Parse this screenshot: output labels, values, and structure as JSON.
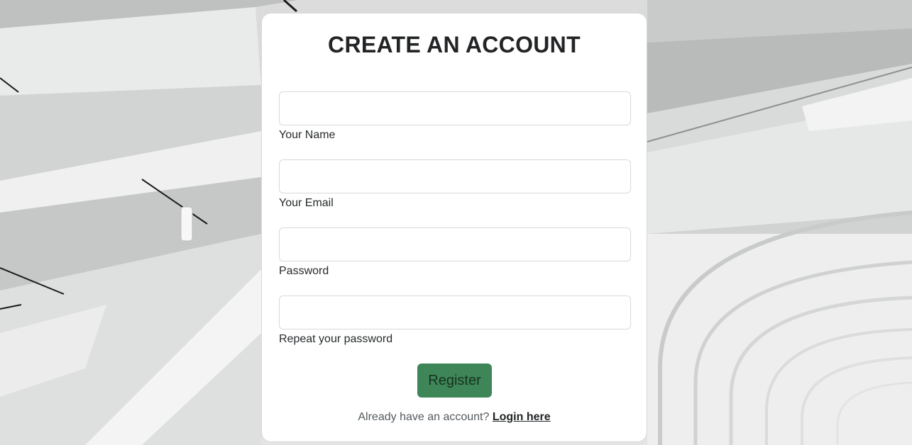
{
  "form": {
    "title": "CREATE AN ACCOUNT",
    "fields": [
      {
        "label": "Your Name",
        "value": "",
        "type": "text"
      },
      {
        "label": "Your Email",
        "value": "",
        "type": "email"
      },
      {
        "label": "Password",
        "value": "",
        "type": "password"
      },
      {
        "label": "Repeat your password",
        "value": "",
        "type": "password"
      }
    ],
    "submit_label": "Register",
    "footer_text": "Already have an account?",
    "login_link": "Login here"
  },
  "colors": {
    "button_bg": "#3e8658",
    "card_bg": "#ffffff",
    "title": "#222426"
  }
}
